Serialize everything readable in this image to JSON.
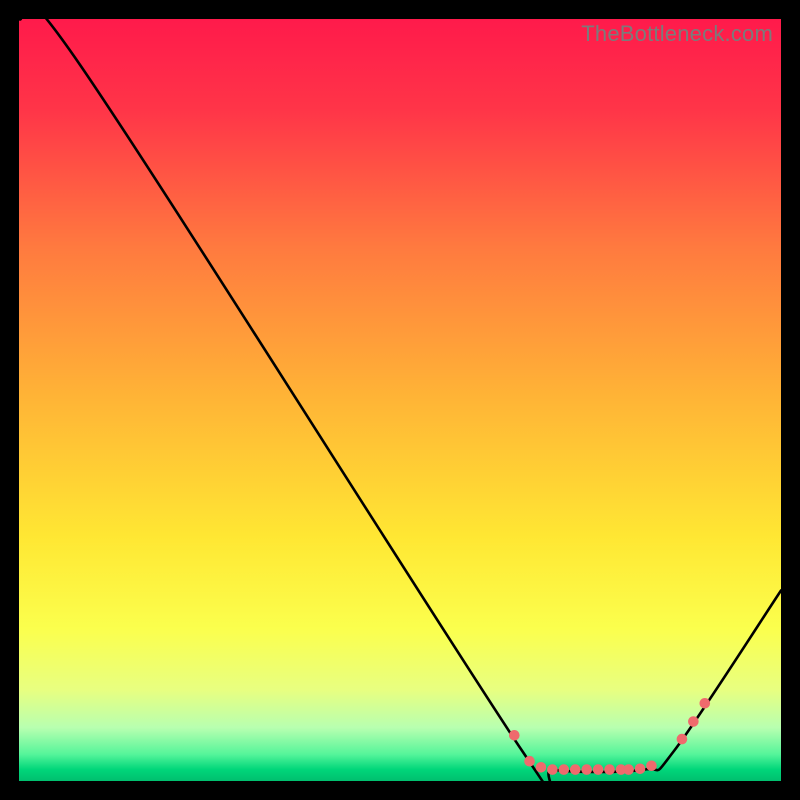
{
  "watermark": "TheBottleneck.com",
  "chart_data": {
    "type": "line",
    "title": "",
    "xlabel": "",
    "ylabel": "",
    "xlim": [
      0,
      100
    ],
    "ylim": [
      0,
      100
    ],
    "curve": {
      "name": "bottleneck-curve",
      "points": [
        {
          "x": 0,
          "y": 100
        },
        {
          "x": 8,
          "y": 94
        },
        {
          "x": 66,
          "y": 4
        },
        {
          "x": 70,
          "y": 1.5
        },
        {
          "x": 82,
          "y": 1.5
        },
        {
          "x": 86,
          "y": 4
        },
        {
          "x": 100,
          "y": 25
        }
      ]
    },
    "markers": {
      "name": "highlight-dots",
      "color": "#ef6a6d",
      "points": [
        {
          "x": 65,
          "y": 6.0
        },
        {
          "x": 67,
          "y": 2.6
        },
        {
          "x": 68.5,
          "y": 1.8
        },
        {
          "x": 70,
          "y": 1.5
        },
        {
          "x": 71.5,
          "y": 1.5
        },
        {
          "x": 73,
          "y": 1.5
        },
        {
          "x": 74.5,
          "y": 1.5
        },
        {
          "x": 76,
          "y": 1.5
        },
        {
          "x": 77.5,
          "y": 1.5
        },
        {
          "x": 79,
          "y": 1.5
        },
        {
          "x": 80,
          "y": 1.5
        },
        {
          "x": 81.5,
          "y": 1.6
        },
        {
          "x": 83,
          "y": 2.0
        },
        {
          "x": 87,
          "y": 5.5
        },
        {
          "x": 88.5,
          "y": 7.8
        },
        {
          "x": 90,
          "y": 10.2
        }
      ]
    },
    "gradient_stops": [
      {
        "offset": 0.0,
        "color": "#ff1a4b"
      },
      {
        "offset": 0.12,
        "color": "#ff3548"
      },
      {
        "offset": 0.3,
        "color": "#ff7a3f"
      },
      {
        "offset": 0.5,
        "color": "#ffb536"
      },
      {
        "offset": 0.68,
        "color": "#ffe733"
      },
      {
        "offset": 0.8,
        "color": "#fbff4d"
      },
      {
        "offset": 0.88,
        "color": "#e8ff80"
      },
      {
        "offset": 0.93,
        "color": "#b8ffb0"
      },
      {
        "offset": 0.965,
        "color": "#55f59a"
      },
      {
        "offset": 0.985,
        "color": "#00d67a"
      },
      {
        "offset": 1.0,
        "color": "#00bf6f"
      }
    ]
  }
}
